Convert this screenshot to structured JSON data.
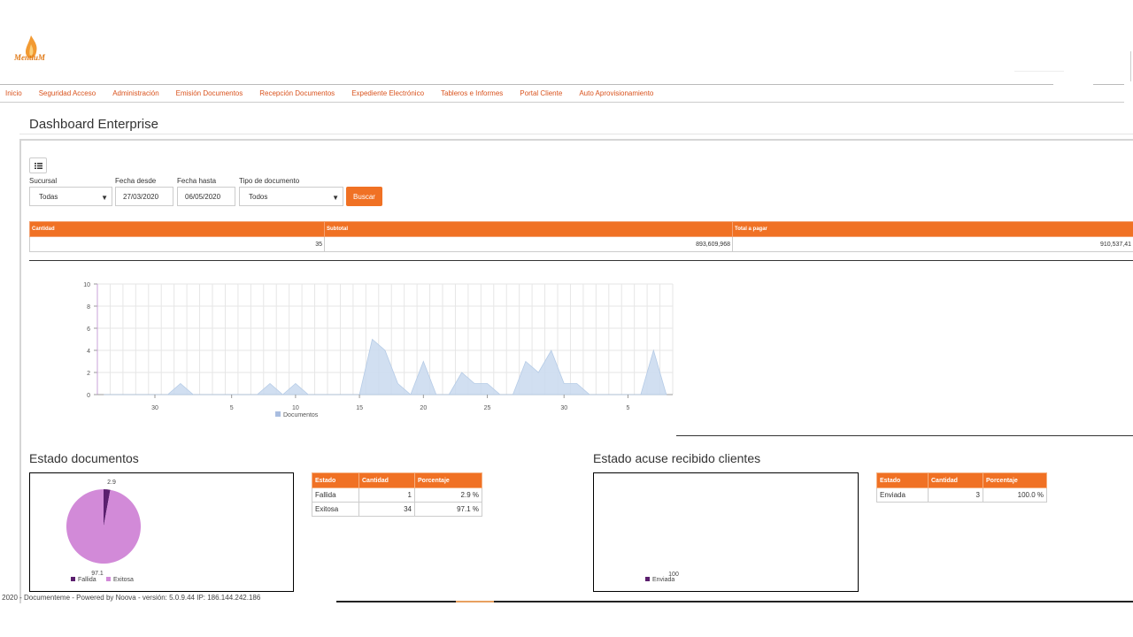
{
  "app": {
    "logo_text": "MentiuM"
  },
  "nav": [
    "Inicio",
    "Seguridad Acceso",
    "Administración",
    "Emisión Documentos",
    "Recepción Documentos",
    "Expediente Electrónico",
    "Tableros e Informes",
    "Portal Cliente",
    "Auto Aprovisionamiento"
  ],
  "page": {
    "title": "Dashboard Enterprise"
  },
  "filters": {
    "sucursal": {
      "label": "Sucursal",
      "value": "Todas"
    },
    "fecha_desde": {
      "label": "Fecha desde",
      "value": "27/03/2020"
    },
    "fecha_hasta": {
      "label": "Fecha hasta",
      "value": "06/05/2020"
    },
    "tipo": {
      "label": "Tipo de documento",
      "value": "Todos"
    },
    "search_label": "Buscar"
  },
  "summary": {
    "headers": [
      "Cantidad",
      "Subtotal",
      "Total a pagar"
    ],
    "values": [
      "35",
      "893,609,968",
      "910,537,41"
    ]
  },
  "chart_data": [
    {
      "type": "area",
      "title": "",
      "series": [
        {
          "name": "Documentos",
          "color": "#c9d9ee",
          "values": [
            0,
            0,
            0,
            0,
            0,
            0,
            1,
            0,
            0,
            0,
            0,
            0,
            0,
            1,
            0,
            1,
            0,
            0,
            0,
            0,
            0,
            5,
            4,
            1,
            0,
            3,
            0,
            0,
            2,
            1,
            1,
            0,
            0,
            3,
            2,
            4,
            1,
            1,
            0,
            0,
            0,
            0,
            0,
            4,
            0
          ]
        }
      ],
      "x_tick_labels": [
        "30",
        "5",
        "10",
        "15",
        "20",
        "25",
        "30",
        "5"
      ],
      "ylim": [
        0,
        10
      ],
      "y_ticks": [
        "0",
        "2",
        "4",
        "6",
        "8",
        "10"
      ],
      "legend": "bottom"
    },
    {
      "type": "pie",
      "title": "Estado documentos",
      "slices": [
        {
          "name": "Fallida",
          "value": 2.9,
          "color": "#5b1f6e"
        },
        {
          "name": "Exitosa",
          "value": 97.1,
          "color": "#d28ad8"
        }
      ],
      "data_labels": [
        "2.9",
        "97.1"
      ],
      "legend": "bottom"
    },
    {
      "type": "pie",
      "title": "Estado acuse recibido clientes",
      "slices": [
        {
          "name": "Enviada",
          "value": 100,
          "color": "#5b1f6e"
        }
      ],
      "data_labels": [
        "100"
      ],
      "legend": "bottom"
    }
  ],
  "estado_documentos": {
    "title": "Estado documentos",
    "headers": [
      "Estado",
      "Cantidad",
      "Porcentaje"
    ],
    "rows": [
      [
        "Fallida",
        "1",
        "2.9 %"
      ],
      [
        "Exitosa",
        "34",
        "97.1 %"
      ]
    ]
  },
  "estado_acuse": {
    "title": "Estado acuse recibido clientes",
    "headers": [
      "Estado",
      "Cantidad",
      "Porcentaje"
    ],
    "rows": [
      [
        "Enviada",
        "3",
        "100.0 %"
      ]
    ]
  },
  "footer": {
    "text": "© 2020 - Documenteme - Powered by Noova - versión: 5.0.9.44 IP: 186.144.242.186"
  }
}
